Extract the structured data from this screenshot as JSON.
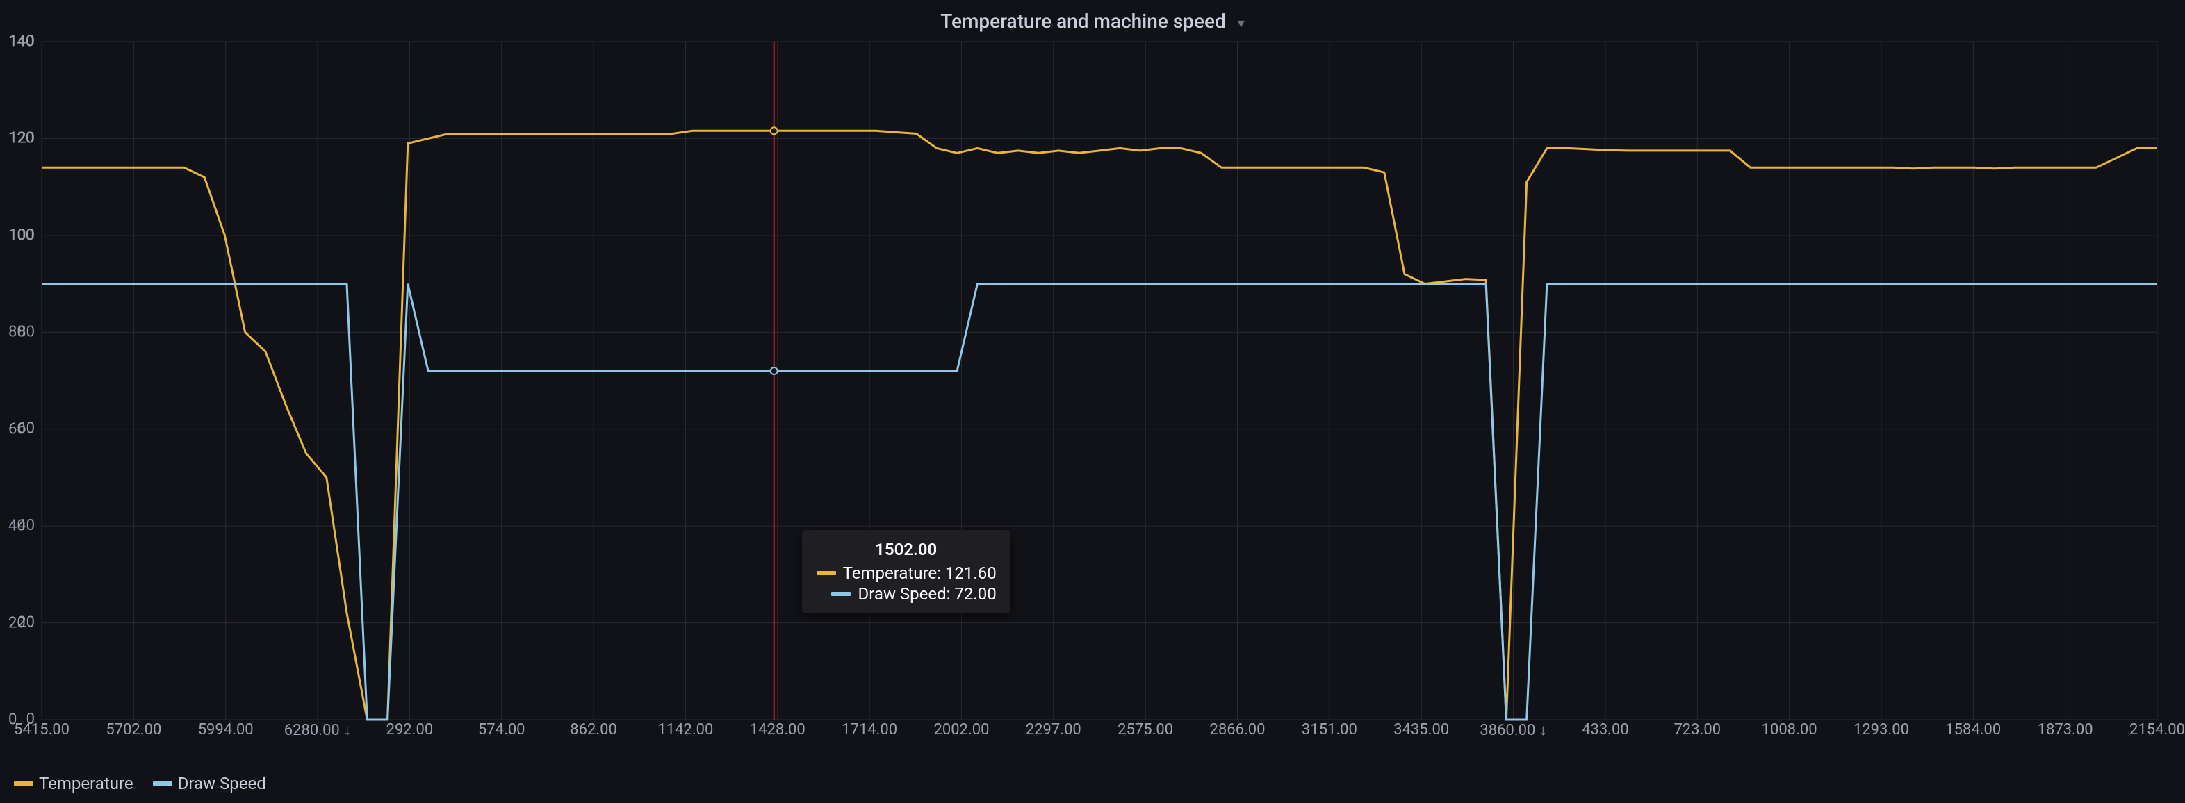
{
  "title": "Temperature and machine speed",
  "legend": [
    {
      "key": "temp",
      "label": "Temperature",
      "color": "#e8b535"
    },
    {
      "key": "speed",
      "label": "Draw Speed",
      "color": "#8ec8e8"
    }
  ],
  "tooltip": {
    "x_label": "1502.00",
    "rows": [
      {
        "series": "Temperature",
        "value": "121.60",
        "color": "#e8b535"
      },
      {
        "series": "Draw Speed",
        "value": "72.00",
        "color": "#8ec8e8"
      }
    ]
  },
  "chart_data": {
    "type": "line",
    "ylabel": "",
    "ylim": [
      0,
      140
    ],
    "yticks": [
      0,
      20,
      40,
      60,
      80,
      100,
      120,
      140
    ],
    "x_index_range": [
      0,
      104
    ],
    "x_tick_labels": [
      "5415.00",
      "5702.00",
      "5994.00",
      "6280.00 ↓",
      "292.00",
      "574.00",
      "862.00",
      "1142.00",
      "1428.00",
      "1714.00",
      "2002.00",
      "2297.00",
      "2575.00",
      "2866.00",
      "3151.00",
      "3435.00",
      "3860.00 ↓",
      "433.00",
      "723.00",
      "1008.00",
      "1293.00",
      "1584.00",
      "1873.00",
      "2154.00"
    ],
    "cursor_index": 36,
    "series": [
      {
        "name": "Temperature",
        "color": "#e8b535",
        "values": [
          114,
          114,
          114,
          114,
          114,
          114,
          114,
          114,
          112,
          100,
          80,
          76,
          65,
          55,
          50,
          22,
          0,
          0,
          119,
          120,
          121,
          121,
          121,
          121,
          121,
          121,
          121,
          121,
          121,
          121,
          121,
          121,
          121.6,
          121.6,
          121.6,
          121.6,
          121.6,
          121.6,
          121.6,
          121.6,
          121.6,
          121.6,
          121.3,
          121,
          118,
          117,
          118,
          117,
          117.5,
          117,
          117.5,
          117,
          117.5,
          118,
          117.5,
          118,
          118,
          117,
          114,
          114,
          114,
          114,
          114,
          114,
          114,
          114,
          113,
          92,
          90,
          90.5,
          91,
          90.8,
          0,
          111,
          118,
          118,
          117.8,
          117.6,
          117.5,
          117.5,
          117.5,
          117.5,
          117.5,
          117.5,
          114,
          114,
          114,
          114,
          114,
          114,
          114,
          114,
          113.8,
          114,
          114,
          114,
          113.8,
          114,
          114,
          114,
          114,
          114,
          116,
          118,
          118
        ]
      },
      {
        "name": "Draw Speed",
        "color": "#8ec8e8",
        "values": [
          90,
          90,
          90,
          90,
          90,
          90,
          90,
          90,
          90,
          90,
          90,
          90,
          90,
          90,
          90,
          90,
          0,
          0,
          90,
          72,
          72,
          72,
          72,
          72,
          72,
          72,
          72,
          72,
          72,
          72,
          72,
          72,
          72,
          72,
          72,
          72,
          72,
          72,
          72,
          72,
          72,
          72,
          72,
          72,
          72,
          72,
          90,
          90,
          90,
          90,
          90,
          90,
          90,
          90,
          90,
          90,
          90,
          90,
          90,
          90,
          90,
          90,
          90,
          90,
          90,
          90,
          90,
          90,
          90,
          90,
          90,
          90,
          0,
          0,
          90,
          90,
          90,
          90,
          90,
          90,
          90,
          90,
          90,
          90,
          90,
          90,
          90,
          90,
          90,
          90,
          90,
          90,
          90,
          90,
          90,
          90,
          90,
          90,
          90,
          90,
          90,
          90,
          90,
          90,
          90
        ]
      }
    ]
  }
}
